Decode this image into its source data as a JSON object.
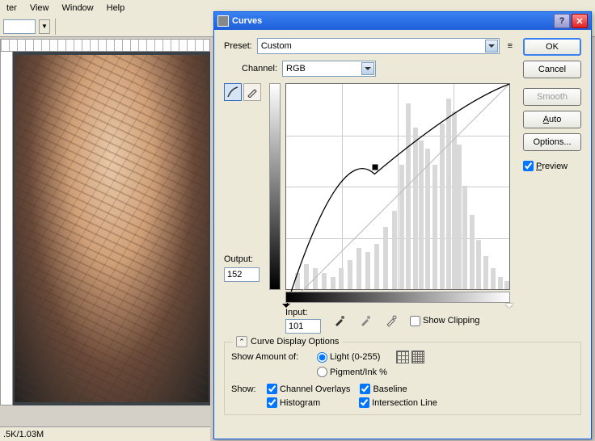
{
  "menu": {
    "items": [
      "ter",
      "View",
      "Window",
      "Help"
    ]
  },
  "status": {
    "text": ".5K/1.03M"
  },
  "dialog": {
    "title": "Curves",
    "preset_label": "Preset:",
    "preset_value": "Custom",
    "channel_label": "Channel:",
    "channel_value": "RGB",
    "output_label": "Output:",
    "output_value": "152",
    "input_label": "Input:",
    "input_value": "101",
    "show_clipping": "Show Clipping",
    "curve_display": "Curve Display Options",
    "show_amount": "Show Amount of:",
    "light": "Light  (0-255)",
    "pigment": "Pigment/Ink %",
    "show": "Show:",
    "channel_overlays": "Channel Overlays",
    "baseline": "Baseline",
    "histogram": "Histogram",
    "intersection": "Intersection Line"
  },
  "buttons": {
    "ok": "OK",
    "cancel": "Cancel",
    "smooth": "Smooth",
    "auto": "Auto",
    "options": "Options...",
    "preview": "Preview"
  },
  "chart_data": {
    "type": "line",
    "title": "Tone Curve",
    "xlabel": "Input",
    "ylabel": "Output",
    "xlim": [
      0,
      255
    ],
    "ylim": [
      0,
      255
    ],
    "points": [
      {
        "x": 0,
        "y": 0
      },
      {
        "x": 101,
        "y": 152
      },
      {
        "x": 255,
        "y": 255
      }
    ],
    "histogram_peaks": [
      {
        "x": 10,
        "h": 8
      },
      {
        "x": 20,
        "h": 12
      },
      {
        "x": 30,
        "h": 10
      },
      {
        "x": 40,
        "h": 8
      },
      {
        "x": 50,
        "h": 6
      },
      {
        "x": 60,
        "h": 10
      },
      {
        "x": 70,
        "h": 14
      },
      {
        "x": 80,
        "h": 20
      },
      {
        "x": 90,
        "h": 18
      },
      {
        "x": 100,
        "h": 22
      },
      {
        "x": 110,
        "h": 30
      },
      {
        "x": 120,
        "h": 38
      },
      {
        "x": 128,
        "h": 60
      },
      {
        "x": 136,
        "h": 90
      },
      {
        "x": 144,
        "h": 78
      },
      {
        "x": 150,
        "h": 72
      },
      {
        "x": 158,
        "h": 68
      },
      {
        "x": 166,
        "h": 60
      },
      {
        "x": 174,
        "h": 80
      },
      {
        "x": 182,
        "h": 92
      },
      {
        "x": 188,
        "h": 86
      },
      {
        "x": 194,
        "h": 70
      },
      {
        "x": 200,
        "h": 50
      },
      {
        "x": 208,
        "h": 36
      },
      {
        "x": 216,
        "h": 24
      },
      {
        "x": 224,
        "h": 16
      },
      {
        "x": 232,
        "h": 10
      },
      {
        "x": 240,
        "h": 6
      },
      {
        "x": 248,
        "h": 4
      }
    ]
  }
}
